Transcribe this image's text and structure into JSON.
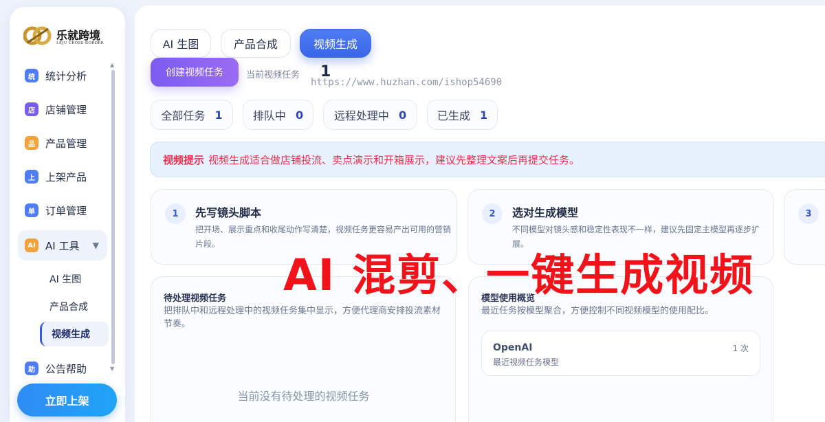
{
  "brand": {
    "name": "乐就跨境",
    "subtitle": "LEJU CROSS-BORDER",
    "logo_color": "#c8962e"
  },
  "sidebar": {
    "items": [
      {
        "badge": "统",
        "label": "统计分析",
        "color": "#4f7df3"
      },
      {
        "badge": "店",
        "label": "店铺管理",
        "color": "#7b5cf0"
      },
      {
        "badge": "品",
        "label": "产品管理",
        "color": "#f3a13a"
      },
      {
        "badge": "上",
        "label": "上架产品",
        "color": "#4f7df3"
      },
      {
        "badge": "单",
        "label": "订单管理",
        "color": "#4f7df3"
      },
      {
        "badge": "AI",
        "label": "AI 工具",
        "color": "#f3a13a",
        "caret": "▼"
      },
      {
        "badge": "助",
        "label": "公告帮助",
        "color": "#4f7df3"
      }
    ],
    "sub_items": [
      "AI 生图",
      "产品合成",
      "视频生成"
    ],
    "publish_button": "立即上架"
  },
  "tabs": [
    "AI 生图",
    "产品合成",
    "视频生成"
  ],
  "active_tab": "视频生成",
  "create_button": "创建视频任务",
  "current_task": {
    "label": "当前视频任务",
    "count": "1"
  },
  "watermark": "https://www.huzhan.com/ishop54690",
  "stats": [
    {
      "label": "全部任务",
      "value": "1"
    },
    {
      "label": "排队中",
      "value": "0"
    },
    {
      "label": "远程处理中",
      "value": "0"
    },
    {
      "label": "已生成",
      "value": "1"
    }
  ],
  "tip": {
    "title": "视频提示",
    "text": "视频生成适合做店铺投流、卖点演示和开箱展示，建议先整理文案后再提交任务。"
  },
  "steps": [
    {
      "num": "1",
      "title": "先写镜头脚本",
      "desc": "把开场、展示重点和收尾动作写清楚，视频任务更容易产出可用的营销片段。"
    },
    {
      "num": "2",
      "title": "选对生成模型",
      "desc": "不同模型对镜头感和稳定性表现不一样，建议先固定主模型再逐步扩展。"
    },
    {
      "num": "3",
      "title": "",
      "desc": ""
    }
  ],
  "overlay_text": "AI 混剪、一键生成视频",
  "pending_panel": {
    "title": "待处理视频任务",
    "desc": "把排队中和远程处理中的视频任务集中显示，方便代理商安排投流素材节奏。",
    "empty": "当前没有待处理的视频任务"
  },
  "model_panel": {
    "title": "模型使用概览",
    "desc": "最近任务按模型聚合，方便控制不同视频模型的使用配比。",
    "models": [
      {
        "name": "OpenAI",
        "desc": "最近视频任务模型",
        "count": "1 次"
      }
    ]
  }
}
